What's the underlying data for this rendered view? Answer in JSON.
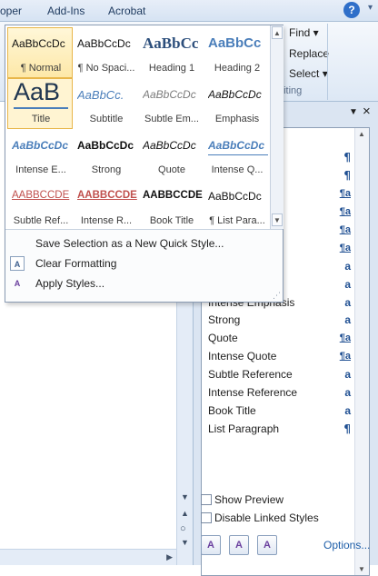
{
  "ribbon": {
    "tabs": [
      "oper",
      "Add-Ins",
      "Acrobat"
    ],
    "help_icon": "question-icon",
    "editing": {
      "find": "Find",
      "replace": "Replace",
      "select": "Select",
      "group_label": "diting"
    }
  },
  "gallery": {
    "tiles": [
      {
        "preview": "AaBbCcDc",
        "label": "¶ Normal"
      },
      {
        "preview": "AaBbCcDc",
        "label": "¶ No Spaci..."
      },
      {
        "preview": "AaBbCc",
        "label": "Heading 1"
      },
      {
        "preview": "AaBbCc",
        "label": "Heading 2"
      },
      {
        "preview": "AaB",
        "label": "Title"
      },
      {
        "preview": "AaBbCc.",
        "label": "Subtitle"
      },
      {
        "preview": "AaBbCcDc",
        "label": "Subtle Em..."
      },
      {
        "preview": "AaBbCcDc",
        "label": "Emphasis"
      },
      {
        "preview": "AaBbCcDc",
        "label": "Intense E..."
      },
      {
        "preview": "AaBbCcDc",
        "label": "Strong"
      },
      {
        "preview": "AaBbCcDc",
        "label": "Quote"
      },
      {
        "preview": "AaBbCcDc",
        "label": "Intense Q..."
      },
      {
        "preview": "AABBCCDE",
        "label": "Subtle Ref..."
      },
      {
        "preview": "AABBCCDE",
        "label": "Intense R..."
      },
      {
        "preview": "AABBCCDE",
        "label": "Book Title"
      },
      {
        "preview": "AaBbCcDc",
        "label": "¶ List Para..."
      }
    ],
    "menu": {
      "save_selection": "Save Selection as a New Quick Style...",
      "clear_formatting": "Clear Formatting",
      "apply_styles": "Apply Styles..."
    }
  },
  "styles_pane": {
    "visible_rows": [
      {
        "name": "Strong",
        "type": "a"
      },
      {
        "name": "Quote",
        "type": "¶a"
      },
      {
        "name": "Intense Quote",
        "type": "¶a"
      },
      {
        "name": "Subtle Reference",
        "type": "a"
      },
      {
        "name": "Intense Reference",
        "type": "a"
      },
      {
        "name": "Book Title",
        "type": "a"
      },
      {
        "name": "List Paragraph",
        "type": "¶"
      }
    ],
    "partial_row": "Intense Emphasis",
    "markers": [
      "¶",
      "¶",
      "¶a",
      "¶a",
      "¶a",
      "¶a",
      "a",
      "a",
      "a"
    ],
    "show_preview": "Show Preview",
    "disable_linked": "Disable Linked Styles",
    "options": "Options..."
  },
  "colors": {
    "accent": "#1f4f92",
    "selection_border": "#e8b64a",
    "link": "#1c5da8"
  }
}
